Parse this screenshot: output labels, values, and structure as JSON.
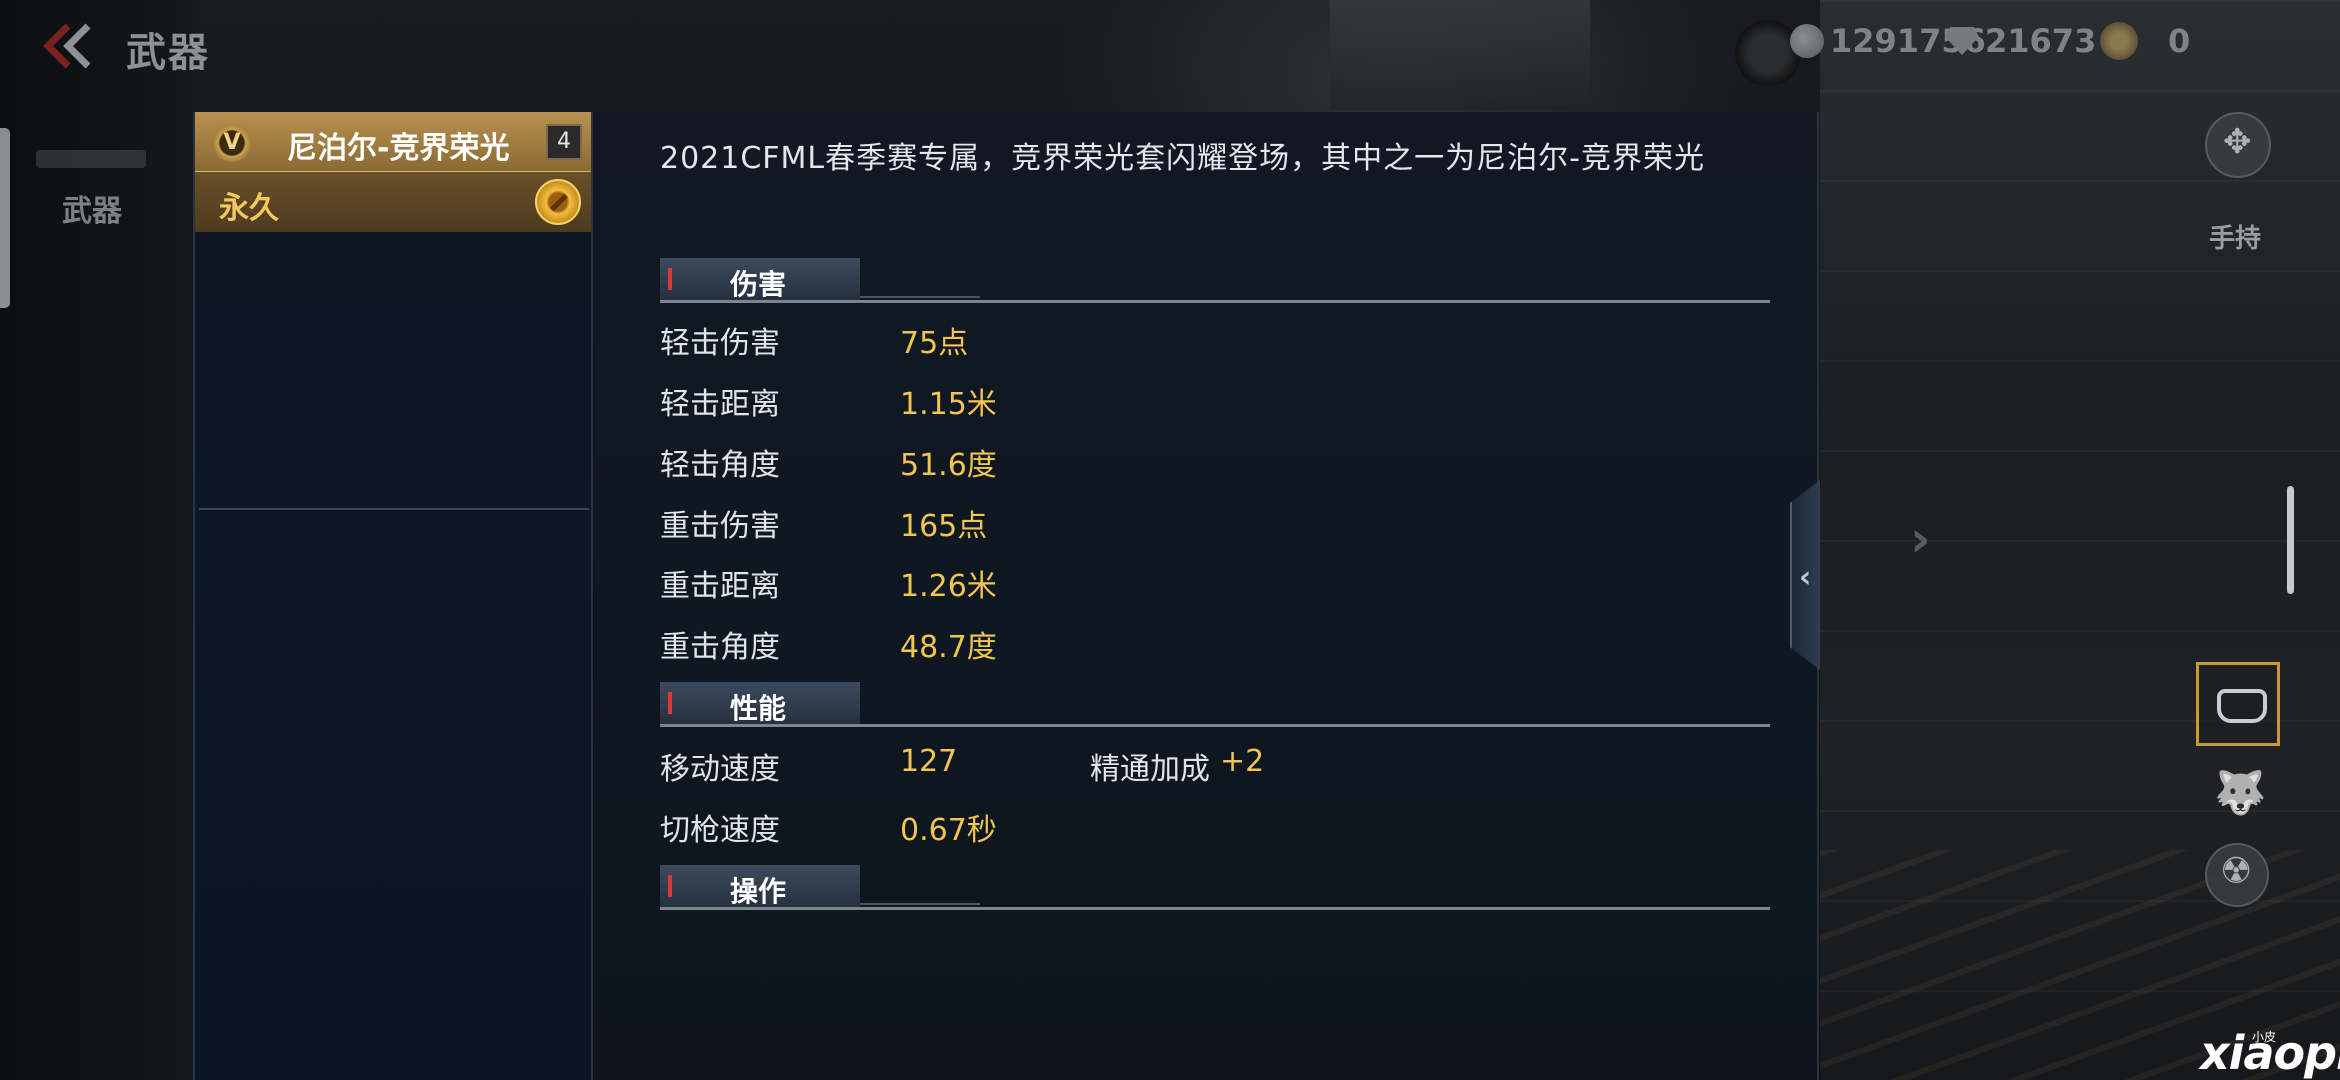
{
  "topbar": {
    "title": "武器",
    "currency_gold": "1291756",
    "currency_diamond": "21673",
    "currency_medal": "0"
  },
  "left_nav": {
    "tab_weapon": "武器"
  },
  "item": {
    "badge": "V",
    "name": "尼泊尔-竞界荣光",
    "count": "4",
    "duration": "永久"
  },
  "detail": {
    "description": "2021CFML春季赛专属，竞界荣光套闪耀登场，其中之一为尼泊尔-竞界荣光",
    "sections": {
      "damage": {
        "label": "伤害",
        "rows": [
          {
            "k": "轻击伤害",
            "v": "75点"
          },
          {
            "k": "轻击距离",
            "v": "1.15米"
          },
          {
            "k": "轻击角度",
            "v": "51.6度"
          },
          {
            "k": "重击伤害",
            "v": "165点"
          },
          {
            "k": "重击距离",
            "v": "1.26米"
          },
          {
            "k": "重击角度",
            "v": "48.7度"
          }
        ]
      },
      "performance": {
        "label": "性能",
        "move_speed_k": "移动速度",
        "move_speed_v": "127",
        "mastery_k": "精通加成",
        "mastery_v": "+2",
        "switch_speed_k": "切枪速度",
        "switch_speed_v": "0.67秒"
      },
      "operation": {
        "label": "操作"
      }
    }
  },
  "right_controls": {
    "hold_label": "手持"
  },
  "watermark": {
    "brand": "xiaopi",
    "sub": "小皮"
  },
  "colors": {
    "accent_gold": "#f1c453",
    "header_gold": "#b99150",
    "panel_bg": "#0f1720"
  }
}
